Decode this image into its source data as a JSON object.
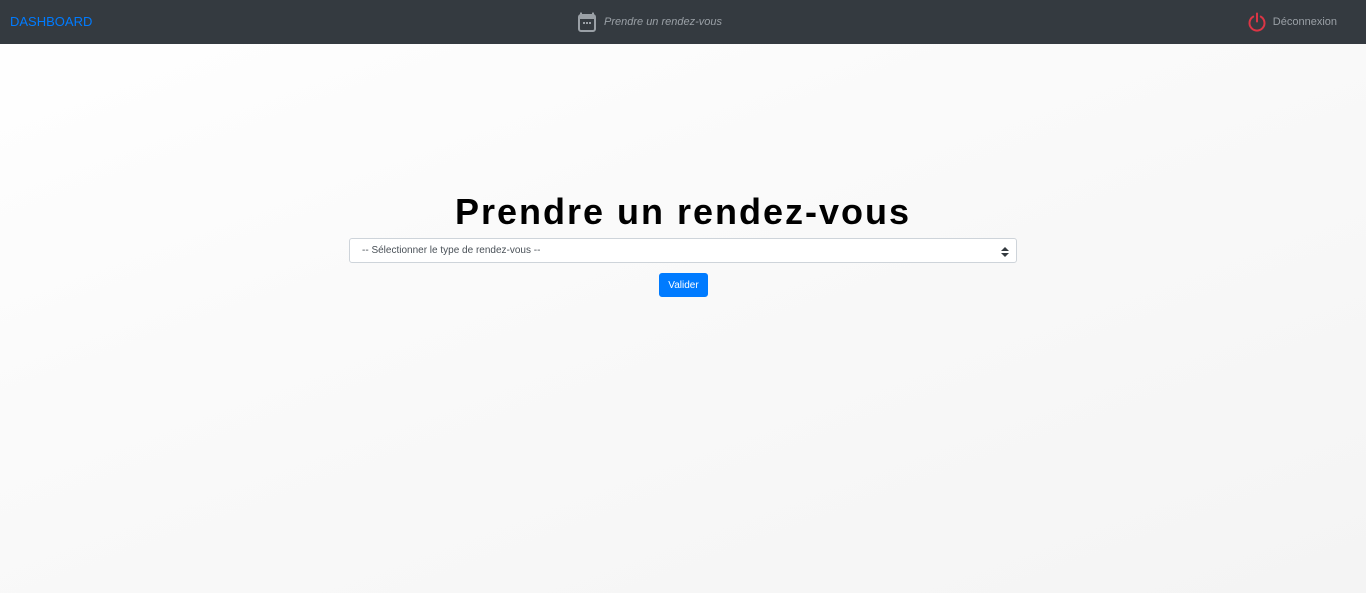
{
  "navbar": {
    "brand": "DASHBOARD",
    "center_link": {
      "label": "Prendre un rendez-vous",
      "icon": "calendar-icon"
    },
    "logout": {
      "label": "Déconnexion",
      "icon": "power-icon"
    },
    "background_color": "#343a40",
    "brand_color": "#007bff",
    "logout_icon_color": "#dc3545"
  },
  "main": {
    "title": "Prendre un rendez-vous",
    "appointment_type_select": {
      "selected": "-- Sélectionner le type de rendez-vous --"
    },
    "submit_label": "Valider",
    "accent_color": "#007bff"
  }
}
